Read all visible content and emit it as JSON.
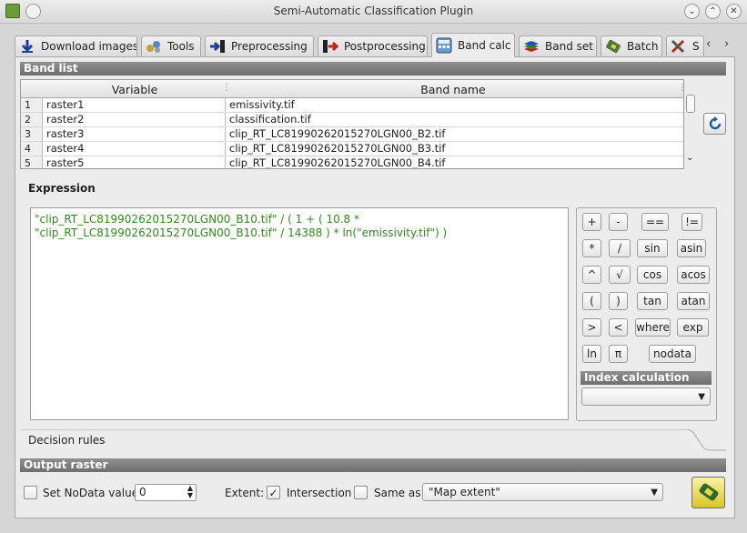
{
  "window": {
    "title": "Semi-Automatic Classification Plugin"
  },
  "tabs": [
    {
      "label": "Download images",
      "icon": "download-icon"
    },
    {
      "label": "Tools",
      "icon": "tools-icon"
    },
    {
      "label": "Preprocessing",
      "icon": "preprocessing-icon"
    },
    {
      "label": "Postprocessing",
      "icon": "postprocessing-icon"
    },
    {
      "label": "Band calc",
      "icon": "band-calc-icon",
      "active": true
    },
    {
      "label": "Band set",
      "icon": "band-set-icon"
    },
    {
      "label": "Batch",
      "icon": "batch-icon"
    },
    {
      "label": "S",
      "icon": "settings-icon"
    }
  ],
  "band_list": {
    "heading": "Band list",
    "columns": [
      "Variable",
      "Band name"
    ],
    "rows": [
      {
        "num": "1",
        "variable": "raster1",
        "band": "emissivity.tif"
      },
      {
        "num": "2",
        "variable": "raster2",
        "band": "classification.tif"
      },
      {
        "num": "3",
        "variable": "raster3",
        "band": "clip_RT_LC81990262015270LGN00_B2.tif"
      },
      {
        "num": "4",
        "variable": "raster4",
        "band": "clip_RT_LC81990262015270LGN00_B3.tif"
      },
      {
        "num": "5",
        "variable": "raster5",
        "band": "clip_RT_LC81990262015270LGN00_B4.tif"
      }
    ]
  },
  "expression": {
    "heading": "Expression",
    "line1": "\"clip_RT_LC81990262015270LGN00_B10.tif\" / ( 1 + ( 10.8 *",
    "line2": "\"clip_RT_LC81990262015270LGN00_B10.tif\" / 14388 ) * ln(\"emissivity.tif\") )"
  },
  "calculator": {
    "buttons": [
      "+",
      "-",
      "==",
      "!=",
      "*",
      "/",
      "sin",
      "asin",
      "^",
      "√",
      "cos",
      "acos",
      "(",
      ")",
      "tan",
      "atan",
      ">",
      "<",
      "where",
      "exp",
      "ln",
      "π",
      "nodata"
    ],
    "index_heading": "Index calculation",
    "index_value": ""
  },
  "decision_rules": {
    "label": "Decision rules"
  },
  "output_raster": {
    "heading": "Output raster",
    "nodata_label": "Set NoData value",
    "nodata_checked": false,
    "nodata_value": "0",
    "extent_label": "Extent:",
    "intersection_label": "Intersection",
    "intersection_checked": true,
    "same_as_label": "Same as",
    "same_as_checked": false,
    "same_as_value": "\"Map extent\""
  }
}
